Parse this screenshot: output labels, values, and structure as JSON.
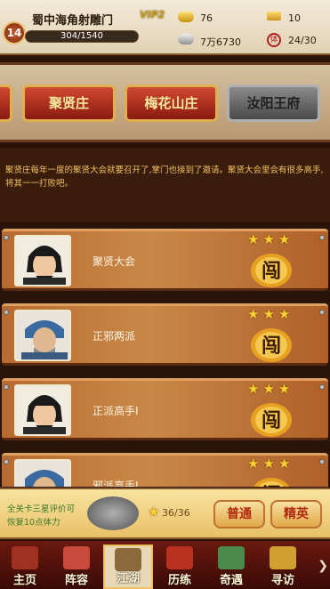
{
  "player": {
    "level": "14",
    "name": "蜀中海角射雕门",
    "vip": "VIP2",
    "xp": "304/1540"
  },
  "resources": {
    "gold": "76",
    "silver": "7万6730",
    "tickets": "10",
    "stamina": "24/30"
  },
  "tabs": [
    {
      "label": "聚贤庄",
      "state": "selected"
    },
    {
      "label": "梅花山庄",
      "state": "normal"
    },
    {
      "label": "汝阳王府",
      "state": "locked"
    }
  ],
  "description": "聚贤庄每年一度的聚贤大会就要召开了,掌门也接到了邀请。聚贤大会里会有很多高手,将其一一打败吧。",
  "stages": [
    {
      "name": "聚贤大会",
      "stars": 3,
      "badge": "闯"
    },
    {
      "name": "正邪两派",
      "stars": 3,
      "badge": "闯"
    },
    {
      "name": "正派高手Ⅰ",
      "stars": 3,
      "badge": "闯"
    },
    {
      "name": "邪派高手Ⅰ",
      "stars": 3,
      "badge": "闯"
    }
  ],
  "bottom": {
    "line1": "全关卡三星评价可",
    "line2": "恢复10点体力",
    "stars": "36/36",
    "normal": "普通",
    "elite": "精英"
  },
  "nav": [
    {
      "label": "主页"
    },
    {
      "label": "阵容"
    },
    {
      "label": "江湖"
    },
    {
      "label": "历练"
    },
    {
      "label": "奇遇"
    },
    {
      "label": "寻访"
    }
  ],
  "colors": {
    "accent": "#b02a10",
    "gold": "#f8d030",
    "wood": "#c88848"
  }
}
